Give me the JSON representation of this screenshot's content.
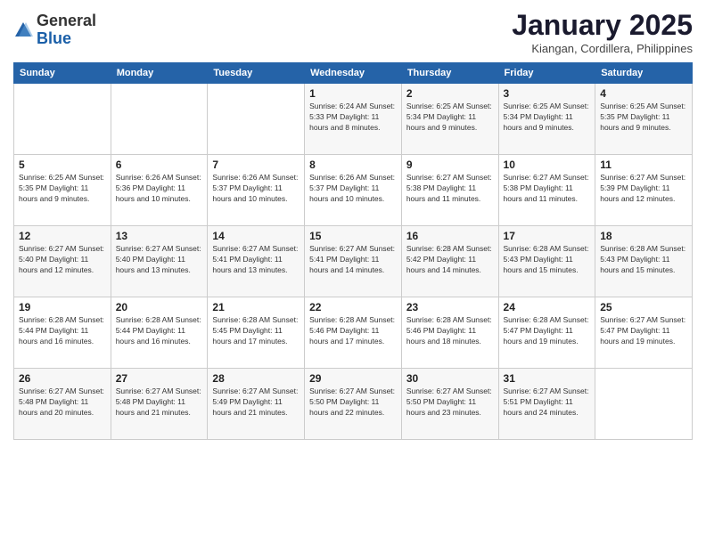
{
  "header": {
    "logo_general": "General",
    "logo_blue": "Blue",
    "month_title": "January 2025",
    "subtitle": "Kiangan, Cordillera, Philippines"
  },
  "days_of_week": [
    "Sunday",
    "Monday",
    "Tuesday",
    "Wednesday",
    "Thursday",
    "Friday",
    "Saturday"
  ],
  "weeks": [
    [
      {
        "day": "",
        "info": ""
      },
      {
        "day": "",
        "info": ""
      },
      {
        "day": "",
        "info": ""
      },
      {
        "day": "1",
        "info": "Sunrise: 6:24 AM\nSunset: 5:33 PM\nDaylight: 11 hours\nand 8 minutes."
      },
      {
        "day": "2",
        "info": "Sunrise: 6:25 AM\nSunset: 5:34 PM\nDaylight: 11 hours\nand 9 minutes."
      },
      {
        "day": "3",
        "info": "Sunrise: 6:25 AM\nSunset: 5:34 PM\nDaylight: 11 hours\nand 9 minutes."
      },
      {
        "day": "4",
        "info": "Sunrise: 6:25 AM\nSunset: 5:35 PM\nDaylight: 11 hours\nand 9 minutes."
      }
    ],
    [
      {
        "day": "5",
        "info": "Sunrise: 6:25 AM\nSunset: 5:35 PM\nDaylight: 11 hours\nand 9 minutes."
      },
      {
        "day": "6",
        "info": "Sunrise: 6:26 AM\nSunset: 5:36 PM\nDaylight: 11 hours\nand 10 minutes."
      },
      {
        "day": "7",
        "info": "Sunrise: 6:26 AM\nSunset: 5:37 PM\nDaylight: 11 hours\nand 10 minutes."
      },
      {
        "day": "8",
        "info": "Sunrise: 6:26 AM\nSunset: 5:37 PM\nDaylight: 11 hours\nand 10 minutes."
      },
      {
        "day": "9",
        "info": "Sunrise: 6:27 AM\nSunset: 5:38 PM\nDaylight: 11 hours\nand 11 minutes."
      },
      {
        "day": "10",
        "info": "Sunrise: 6:27 AM\nSunset: 5:38 PM\nDaylight: 11 hours\nand 11 minutes."
      },
      {
        "day": "11",
        "info": "Sunrise: 6:27 AM\nSunset: 5:39 PM\nDaylight: 11 hours\nand 12 minutes."
      }
    ],
    [
      {
        "day": "12",
        "info": "Sunrise: 6:27 AM\nSunset: 5:40 PM\nDaylight: 11 hours\nand 12 minutes."
      },
      {
        "day": "13",
        "info": "Sunrise: 6:27 AM\nSunset: 5:40 PM\nDaylight: 11 hours\nand 13 minutes."
      },
      {
        "day": "14",
        "info": "Sunrise: 6:27 AM\nSunset: 5:41 PM\nDaylight: 11 hours\nand 13 minutes."
      },
      {
        "day": "15",
        "info": "Sunrise: 6:27 AM\nSunset: 5:41 PM\nDaylight: 11 hours\nand 14 minutes."
      },
      {
        "day": "16",
        "info": "Sunrise: 6:28 AM\nSunset: 5:42 PM\nDaylight: 11 hours\nand 14 minutes."
      },
      {
        "day": "17",
        "info": "Sunrise: 6:28 AM\nSunset: 5:43 PM\nDaylight: 11 hours\nand 15 minutes."
      },
      {
        "day": "18",
        "info": "Sunrise: 6:28 AM\nSunset: 5:43 PM\nDaylight: 11 hours\nand 15 minutes."
      }
    ],
    [
      {
        "day": "19",
        "info": "Sunrise: 6:28 AM\nSunset: 5:44 PM\nDaylight: 11 hours\nand 16 minutes."
      },
      {
        "day": "20",
        "info": "Sunrise: 6:28 AM\nSunset: 5:44 PM\nDaylight: 11 hours\nand 16 minutes."
      },
      {
        "day": "21",
        "info": "Sunrise: 6:28 AM\nSunset: 5:45 PM\nDaylight: 11 hours\nand 17 minutes."
      },
      {
        "day": "22",
        "info": "Sunrise: 6:28 AM\nSunset: 5:46 PM\nDaylight: 11 hours\nand 17 minutes."
      },
      {
        "day": "23",
        "info": "Sunrise: 6:28 AM\nSunset: 5:46 PM\nDaylight: 11 hours\nand 18 minutes."
      },
      {
        "day": "24",
        "info": "Sunrise: 6:28 AM\nSunset: 5:47 PM\nDaylight: 11 hours\nand 19 minutes."
      },
      {
        "day": "25",
        "info": "Sunrise: 6:27 AM\nSunset: 5:47 PM\nDaylight: 11 hours\nand 19 minutes."
      }
    ],
    [
      {
        "day": "26",
        "info": "Sunrise: 6:27 AM\nSunset: 5:48 PM\nDaylight: 11 hours\nand 20 minutes."
      },
      {
        "day": "27",
        "info": "Sunrise: 6:27 AM\nSunset: 5:48 PM\nDaylight: 11 hours\nand 21 minutes."
      },
      {
        "day": "28",
        "info": "Sunrise: 6:27 AM\nSunset: 5:49 PM\nDaylight: 11 hours\nand 21 minutes."
      },
      {
        "day": "29",
        "info": "Sunrise: 6:27 AM\nSunset: 5:50 PM\nDaylight: 11 hours\nand 22 minutes."
      },
      {
        "day": "30",
        "info": "Sunrise: 6:27 AM\nSunset: 5:50 PM\nDaylight: 11 hours\nand 23 minutes."
      },
      {
        "day": "31",
        "info": "Sunrise: 6:27 AM\nSunset: 5:51 PM\nDaylight: 11 hours\nand 24 minutes."
      },
      {
        "day": "",
        "info": ""
      }
    ]
  ]
}
